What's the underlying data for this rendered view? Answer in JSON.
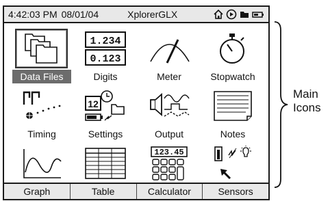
{
  "statusbar": {
    "time": "4:42:03 PM",
    "date": "08/01/04",
    "device": "XplorerGLX",
    "icons": [
      "home-icon",
      "play-icon",
      "folder-icon",
      "battery-icon"
    ]
  },
  "icons": [
    {
      "label": "Data Files",
      "icon": "data-files-icon",
      "selected": true
    },
    {
      "label": "Digits",
      "icon": "digits-icon",
      "readout1": "1.234",
      "readout2": "0.123"
    },
    {
      "label": "Meter",
      "icon": "meter-icon"
    },
    {
      "label": "Stopwatch",
      "icon": "stopwatch-icon"
    },
    {
      "label": "Timing",
      "icon": "timing-icon"
    },
    {
      "label": "Settings",
      "icon": "settings-icon",
      "readout": "12"
    },
    {
      "label": "Output",
      "icon": "output-icon"
    },
    {
      "label": "Notes",
      "icon": "notes-icon"
    },
    {
      "label": "",
      "icon": "graph-icon"
    },
    {
      "label": "",
      "icon": "table-icon"
    },
    {
      "label": "",
      "icon": "calculator-icon",
      "readout": "123.45"
    },
    {
      "label": "",
      "icon": "sensors-icon"
    }
  ],
  "tabs": [
    "Graph",
    "Table",
    "Calculator",
    "Sensors"
  ],
  "annotation": {
    "line1": "Main",
    "line2": "Icons"
  }
}
